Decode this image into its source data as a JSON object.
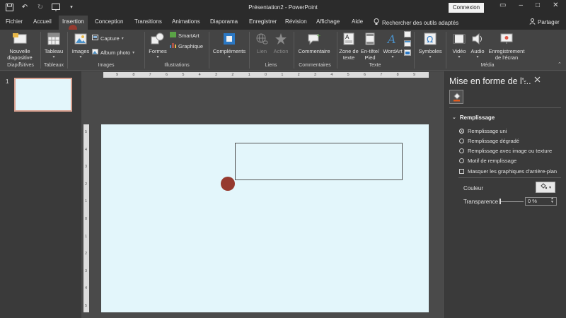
{
  "app": {
    "doc_title": "Présentation2  -  PowerPoint",
    "connexion_label": "Connexion",
    "partager_label": "Partager",
    "search_label": "Rechercher des outils adaptés"
  },
  "tabs": [
    "Fichier",
    "Accueil",
    "Insertion",
    "Conception",
    "Transitions",
    "Animations",
    "Diaporama",
    "Enregistrer",
    "Révision",
    "Affichage",
    "Aide"
  ],
  "active_tab": "Insertion",
  "ribbon": {
    "nouvelle_diapositive": "Nouvelle diapositive",
    "tableau": "Tableau",
    "images": "Images",
    "capture": "Capture",
    "album_photo": "Album photo",
    "formes": "Formes",
    "smartart": "SmartArt",
    "graphique": "Graphique",
    "complements": "Compléments",
    "lien": "Lien",
    "action": "Action",
    "commentaire": "Commentaire",
    "zone_de_texte": "Zone de texte",
    "en_tete_pied": "En-tête/ Pied",
    "wordart": "WordArt",
    "symboles": "Symboles",
    "video": "Vidéo",
    "audio": "Audio",
    "enregistrement_ecran": "Enregistrement de l'écran",
    "groups": {
      "diapositives": "Diapositives",
      "tableaux": "Tableaux",
      "images": "Images",
      "illustrations": "Illustrations",
      "liens": "Liens",
      "commentaires": "Commentaires",
      "texte": "Texte",
      "media": "Média"
    }
  },
  "thumbnails": {
    "slide_number": "1"
  },
  "rulers": {
    "horizontal": [
      "9",
      "8",
      "7",
      "6",
      "5",
      "4",
      "3",
      "2",
      "1",
      "0",
      "1",
      "2",
      "3",
      "4",
      "5",
      "6",
      "7",
      "8",
      "9"
    ],
    "vertical": [
      "5",
      "4",
      "3",
      "2",
      "1",
      "0",
      "1",
      "2",
      "3",
      "4",
      "5"
    ]
  },
  "format_pane": {
    "title": "Mise en forme de l'...",
    "section": "Remplissage",
    "options": [
      {
        "label": "Remplissage uni",
        "type": "radio",
        "selected": true
      },
      {
        "label": "Remplissage dégradé",
        "type": "radio",
        "selected": false
      },
      {
        "label": "Remplissage avec image ou texture",
        "type": "radio",
        "selected": false
      },
      {
        "label": "Motif de remplissage",
        "type": "radio",
        "selected": false
      },
      {
        "label": "Masquer les graphiques d'arrière-plan",
        "type": "checkbox",
        "selected": false
      }
    ],
    "couleur_label": "Couleur",
    "transparence_label": "Transparence",
    "transparence_value": "0 %"
  },
  "colors": {
    "slide_bg": "#e3f6fb",
    "marker": "#963a2f",
    "thumb_border": "#d9a08f"
  }
}
